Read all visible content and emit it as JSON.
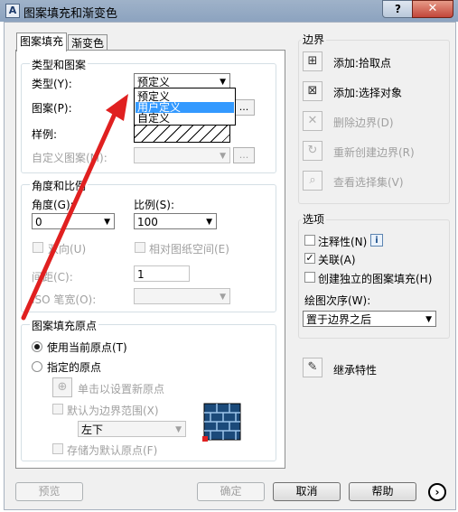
{
  "window": {
    "title": "图案填充和渐变色",
    "help_btn": "?",
    "close_btn": "✕",
    "app_icon": "A"
  },
  "tabs": [
    {
      "label": "图案填充"
    },
    {
      "label": "渐变色"
    }
  ],
  "type_pattern": {
    "title": "类型和图案",
    "type_label": "类型(Y):",
    "type_value": "预定义",
    "type_options": [
      "预定义",
      "用户定义",
      "自定义"
    ],
    "pattern_label": "图案(P):",
    "swatch_label": "样例:",
    "custom_label": "自定义图案(M):",
    "ellipsis": "..."
  },
  "angle_scale": {
    "title": "角度和比例",
    "angle_label": "角度(G):",
    "angle_value": "0",
    "scale_label": "比例(S):",
    "scale_value": "100",
    "double_label": "双向(U)",
    "relative_label": "相对图纸空间(E)",
    "spacing_label": "间距(C):",
    "spacing_value": "1",
    "iso_label": "ISO 笔宽(O):"
  },
  "origin": {
    "title": "图案填充原点",
    "use_current": "使用当前原点(T)",
    "specified": "指定的原点",
    "click_set": "单击以设置新原点",
    "default_extent": "默认为边界范围(X)",
    "extent_value": "左下",
    "store_default": "存储为默认原点(F)"
  },
  "boundary": {
    "title": "边界",
    "add_pick": "添加:拾取点",
    "add_select": "添加:选择对象",
    "remove": "删除边界(D)",
    "recreate": "重新创建边界(R)",
    "view": "查看选择集(V)"
  },
  "options": {
    "title": "选项",
    "annotative": "注释性(N)",
    "associative": "关联(A)",
    "separate": "创建独立的图案填充(H)",
    "draw_order_label": "绘图次序(W):",
    "draw_order_value": "置于边界之后",
    "info_icon": "i"
  },
  "inherit": "继承特性",
  "footer": {
    "preview": "预览",
    "ok": "确定",
    "cancel": "取消",
    "help": "帮助",
    "more": "›"
  },
  "colors": {
    "accent": "#3399ff",
    "arrow": "#e02020"
  }
}
